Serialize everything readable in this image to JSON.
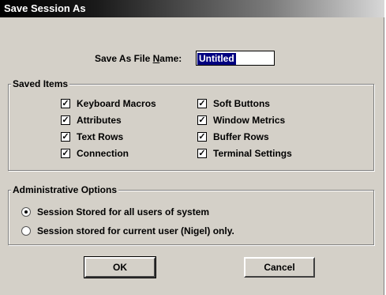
{
  "window": {
    "title": "Save Session As"
  },
  "filename": {
    "label_pre": "Save As File ",
    "label_accel": "N",
    "label_post": "ame:",
    "value": "Untitled"
  },
  "saved_items": {
    "title": "Saved Items",
    "left": [
      {
        "label": "Keyboard Macros",
        "checked": true
      },
      {
        "label": "Attributes",
        "checked": true
      },
      {
        "label": "Text Rows",
        "checked": true
      },
      {
        "label": "Connection",
        "checked": true
      }
    ],
    "right": [
      {
        "label": "Soft Buttons",
        "checked": true
      },
      {
        "label": "Window Metrics",
        "checked": true
      },
      {
        "label": "Buffer Rows",
        "checked": true
      },
      {
        "label": "Terminal Settings",
        "checked": true
      }
    ]
  },
  "admin": {
    "title": "Administrative Options",
    "options": [
      {
        "label": "Session Stored for all users of system",
        "selected": true
      },
      {
        "label": "Session stored for current user (Nigel) only.",
        "selected": false
      }
    ]
  },
  "buttons": {
    "ok": "OK",
    "cancel": "Cancel"
  },
  "check_glyph": "✓"
}
